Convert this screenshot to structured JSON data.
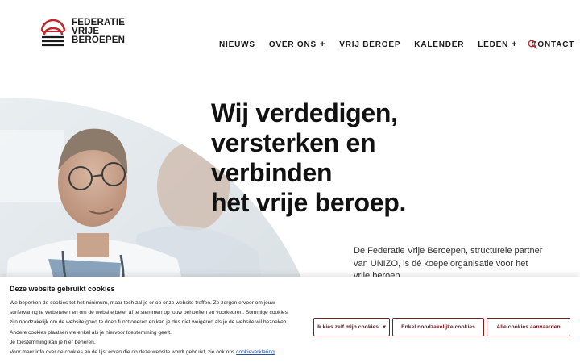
{
  "brand": {
    "name_lines": [
      "FEDERATIE",
      "VRIJE",
      "BEROEPEN"
    ],
    "accent_color": "#c2272d"
  },
  "nav": {
    "items": [
      {
        "label": "NIEUWS",
        "has_submenu": false
      },
      {
        "label": "OVER ONS",
        "has_submenu": true
      },
      {
        "label": "VRIJ BEROEP",
        "has_submenu": false
      },
      {
        "label": "KALENDER",
        "has_submenu": false
      },
      {
        "label": "LEDEN",
        "has_submenu": true
      },
      {
        "label": "CONTACT",
        "has_submenu": false
      }
    ],
    "submenu_symbol": "+",
    "search_icon": "search-icon"
  },
  "hero": {
    "headline_lines": [
      "Wij verdedigen,",
      "versterken en",
      "verbinden",
      "het vrije beroep."
    ],
    "intro": "De Federatie Vrije Beroepen, structurele partner van UNIZO, is dé koepelorganisatie voor het vrije beroep."
  },
  "cookies": {
    "title": "Deze website gebruikt cookies",
    "lines": [
      "We beperken de cookies tot het minimum, maar toch zal je er op onze website treffen. Ze zorgen ervoor om jouw",
      "surfervaring te verbeteren en om de website beter af te stemmen op jouw behoeften en voorkeuren. Sommige cookies",
      "zijn noodzakelijk om de website goed te doen functioneren en kan je dus niet weigeren als je de website wil bezoeken.",
      "Andere cookies plaatsen we enkel als je hiervoor toestemming geeft.",
      "Je toestemming kan je hier beheren."
    ],
    "last_line_prefix": "Voor meer info over de cookies en de lijst ervan die op deze website wordt gebruikt, zie ook ons",
    "link_label": "cookieverklaring",
    "buttons": {
      "choose": "Ik kies zelf mijn cookies",
      "necessary": "Enkel noodzakelijke cookies",
      "all": "Alle cookies aanvaarden"
    },
    "button_color": "#7a1e24"
  }
}
